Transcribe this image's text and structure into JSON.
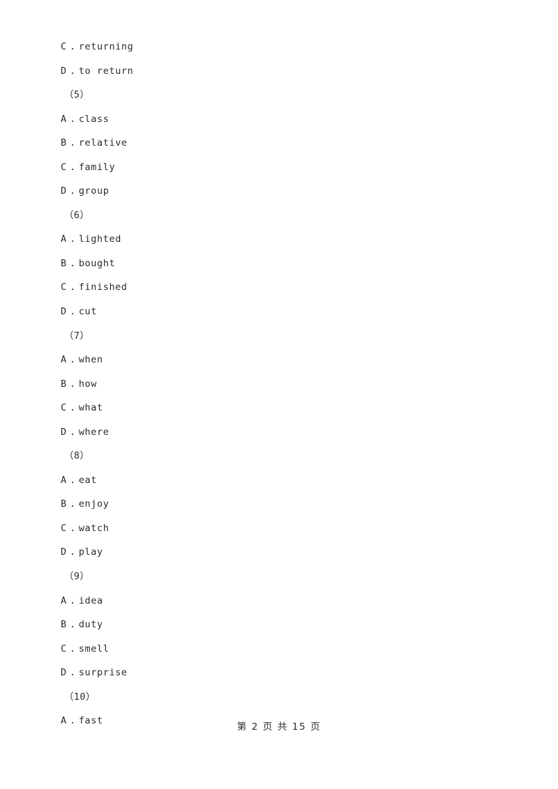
{
  "page": {
    "background_color": "#ffffff",
    "text_color": "#2b2b2b"
  },
  "body_lines": [
    {
      "kind": "option",
      "letter": "C",
      "separator": ".",
      "text": "returning"
    },
    {
      "kind": "option",
      "letter": "D",
      "separator": ".",
      "text": "to return"
    },
    {
      "kind": "question_number",
      "text": "（5）"
    },
    {
      "kind": "option",
      "letter": "A",
      "separator": ".",
      "text": "class"
    },
    {
      "kind": "option",
      "letter": "B",
      "separator": ".",
      "text": "relative"
    },
    {
      "kind": "option",
      "letter": "C",
      "separator": ".",
      "text": "family"
    },
    {
      "kind": "option",
      "letter": "D",
      "separator": ".",
      "text": "group"
    },
    {
      "kind": "question_number",
      "text": "（6）"
    },
    {
      "kind": "option",
      "letter": "A",
      "separator": ".",
      "text": "lighted"
    },
    {
      "kind": "option",
      "letter": "B",
      "separator": ".",
      "text": "bought"
    },
    {
      "kind": "option",
      "letter": "C",
      "separator": ".",
      "text": "finished"
    },
    {
      "kind": "option",
      "letter": "D",
      "separator": ".",
      "text": "cut"
    },
    {
      "kind": "question_number",
      "text": "（7）"
    },
    {
      "kind": "option",
      "letter": "A",
      "separator": ".",
      "text": "when"
    },
    {
      "kind": "option",
      "letter": "B",
      "separator": ".",
      "text": "how"
    },
    {
      "kind": "option",
      "letter": "C",
      "separator": ".",
      "text": "what"
    },
    {
      "kind": "option",
      "letter": "D",
      "separator": ".",
      "text": "where"
    },
    {
      "kind": "question_number",
      "text": "（8）"
    },
    {
      "kind": "option",
      "letter": "A",
      "separator": ".",
      "text": "eat"
    },
    {
      "kind": "option",
      "letter": "B",
      "separator": ".",
      "text": "enjoy"
    },
    {
      "kind": "option",
      "letter": "C",
      "separator": ".",
      "text": "watch"
    },
    {
      "kind": "option",
      "letter": "D",
      "separator": ".",
      "text": "play"
    },
    {
      "kind": "question_number",
      "text": "（9）"
    },
    {
      "kind": "option",
      "letter": "A",
      "separator": ".",
      "text": "idea"
    },
    {
      "kind": "option",
      "letter": "B",
      "separator": ".",
      "text": "duty"
    },
    {
      "kind": "option",
      "letter": "C",
      "separator": ".",
      "text": "smell"
    },
    {
      "kind": "option",
      "letter": "D",
      "separator": ".",
      "text": "surprise"
    },
    {
      "kind": "question_number",
      "text": "（10）"
    },
    {
      "kind": "option",
      "letter": "A",
      "separator": ".",
      "text": "fast"
    }
  ],
  "footer": {
    "text": "第 2 页 共 15 页",
    "current_page": "2",
    "total_pages": "15"
  }
}
